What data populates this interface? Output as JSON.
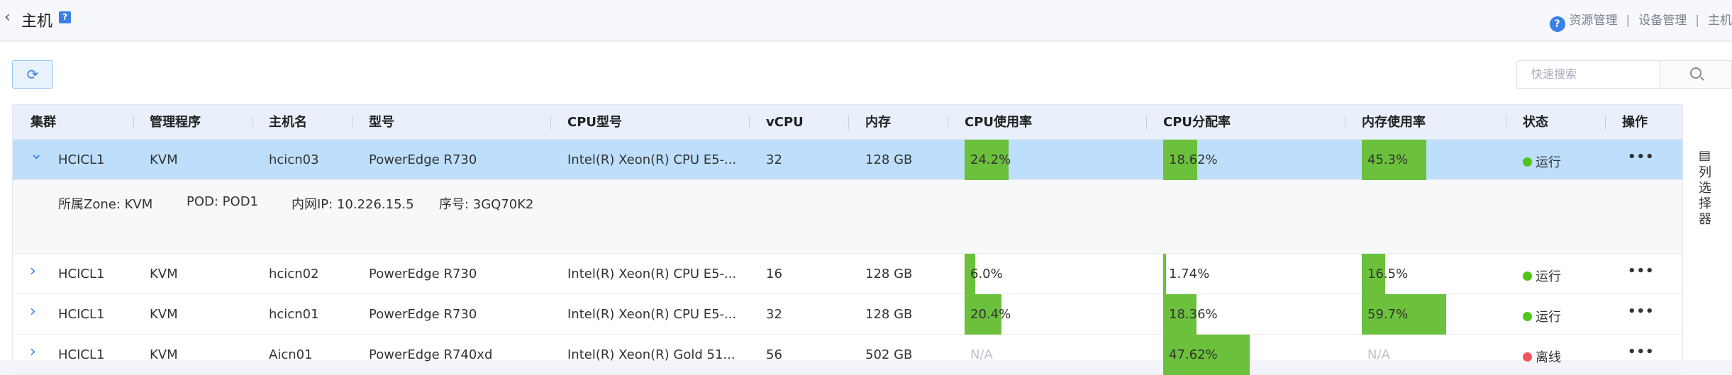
{
  "header": {
    "back_icon": "chevron-left-icon",
    "title": "主机",
    "help_badge": "?",
    "crumb_help": "?",
    "breadcrumb": [
      "资源管理",
      "设备管理",
      "主机"
    ],
    "breadcrumb_sep": "|"
  },
  "toolbar": {
    "refresh_icon": "⟳",
    "search_placeholder": "快速搜索"
  },
  "columns": [
    "集群",
    "管理程序",
    "主机名",
    "型号",
    "CPU型号",
    "vCPU",
    "内存",
    "CPU使用率",
    "CPU分配率",
    "内存使用率",
    "状态",
    "操作"
  ],
  "rows": [
    {
      "cluster": "HCICL1",
      "hypervisor": "KVM",
      "hostname": "hcicn03",
      "model": "PowerEdge R730",
      "cpu_model": "Intel(R) Xeon(R) CPU E5-...",
      "vcpu": "32",
      "memory": "128 GB",
      "cpu_usage": "24.2%",
      "cpu_usage_val": 24.2,
      "cpu_alloc": "18.62%",
      "cpu_alloc_val": 18.62,
      "mem_usage": "45.3%",
      "mem_usage_val": 45.3,
      "status": "运行",
      "status_color": "#52c41a",
      "expanded": true
    },
    {
      "cluster": "HCICL1",
      "hypervisor": "KVM",
      "hostname": "hcicn02",
      "model": "PowerEdge R730",
      "cpu_model": "Intel(R) Xeon(R) CPU E5-...",
      "vcpu": "16",
      "memory": "128 GB",
      "cpu_usage": "6.0%",
      "cpu_usage_val": 6.0,
      "cpu_alloc": "1.74%",
      "cpu_alloc_val": 1.74,
      "mem_usage": "16.5%",
      "mem_usage_val": 16.5,
      "status": "运行",
      "status_color": "#52c41a",
      "expanded": false
    },
    {
      "cluster": "HCICL1",
      "hypervisor": "KVM",
      "hostname": "hcicn01",
      "model": "PowerEdge R730",
      "cpu_model": "Intel(R) Xeon(R) CPU E5-...",
      "vcpu": "32",
      "memory": "128 GB",
      "cpu_usage": "20.4%",
      "cpu_usage_val": 20.4,
      "cpu_alloc": "18.36%",
      "cpu_alloc_val": 18.36,
      "mem_usage": "59.7%",
      "mem_usage_val": 59.7,
      "status": "运行",
      "status_color": "#52c41a",
      "expanded": false
    },
    {
      "cluster": "HCICL1",
      "hypervisor": "KVM",
      "hostname": "Aicn01",
      "model": "PowerEdge R740xd",
      "cpu_model": "Intel(R) Xeon(R) Gold 51...",
      "vcpu": "56",
      "memory": "502 GB",
      "cpu_usage": "N/A",
      "cpu_usage_val": null,
      "cpu_alloc": "47.62%",
      "cpu_alloc_val": 47.62,
      "mem_usage": "N/A",
      "mem_usage_val": null,
      "status": "离线",
      "status_color": "#f0555a",
      "expanded": false
    }
  ],
  "detail": {
    "zone": "所属Zone: KVM",
    "pod": "POD: POD1",
    "ip": "内网IP: 10.226.15.5",
    "serial": "序号: 3GQ70K2"
  },
  "ops_label": "•••",
  "side_tab": {
    "icon": "columns-icon",
    "label": "列选择器"
  },
  "colors": {
    "accent": "#3a80e6",
    "bar": "#6bc03c",
    "selected_row": "#bedffb",
    "header_bg": "#eaf0fb"
  }
}
